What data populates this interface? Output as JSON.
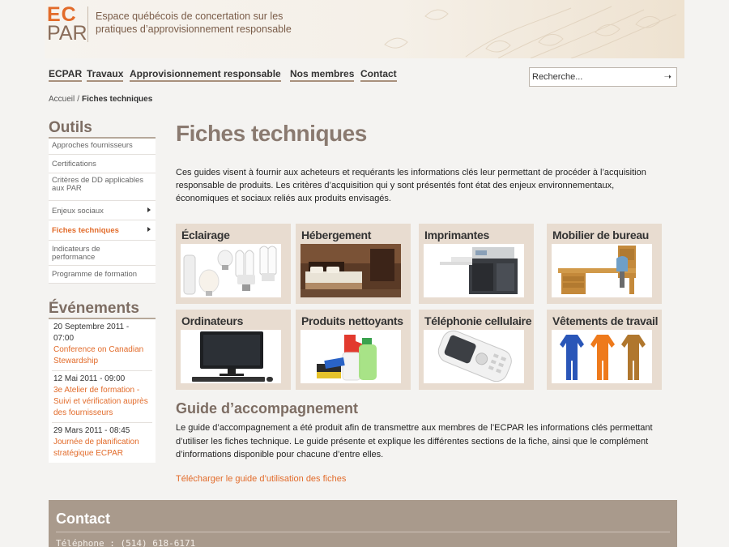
{
  "header": {
    "logo_top": "EC",
    "logo_bottom": "PAR",
    "tagline_line1": "Espace québécois de concertation sur les",
    "tagline_line2": "pratiques d’approvisionnement responsable"
  },
  "nav": {
    "items": [
      "ECPAR",
      "Travaux",
      "Approvisionnement responsable",
      "Nos membres",
      "Contact"
    ]
  },
  "search": {
    "placeholder": "Recherche...",
    "button_icon": "arrow-right-icon"
  },
  "breadcrumb": {
    "home": "Accueil",
    "separator": "/",
    "current": "Fiches techniques"
  },
  "sidebar": {
    "tools_title": "Outils",
    "tools": [
      {
        "label": "Approches fournisseurs"
      },
      {
        "label": "Certifications"
      },
      {
        "label": "Critères de DD applicables aux PAR"
      },
      {
        "label": "Enjeux sociaux"
      },
      {
        "label": "Fiches techniques"
      },
      {
        "label": "Indicateurs de performance"
      },
      {
        "label": "Programme de formation"
      }
    ],
    "events_title": "Événements",
    "events": [
      {
        "date": "20 Septembre 2011 - 07:00",
        "title": "Conference on Canadian Stewardship"
      },
      {
        "date": "12 Mai 2011 - 09:00",
        "title": "3e Atelier de formation - Suivi et vérification auprès des fournisseurs"
      },
      {
        "date": "29 Mars 2011 - 08:45",
        "title": "Journée de planification stratégique ECPAR"
      }
    ]
  },
  "main": {
    "title": "Fiches techniques",
    "intro": "Ces guides visent à fournir aux acheteurs et requérants les informations clés leur permettant de procéder à l’acquisition responsable de produits. Les critères d’acquisition qui y sont présentés font état des enjeux environnementaux, économiques et sociaux reliés aux produits envisagés.",
    "tiles": [
      {
        "label": "Éclairage",
        "icon": "light-bulbs-image"
      },
      {
        "label": "Hébergement",
        "icon": "hotel-room-image"
      },
      {
        "label": "Imprimantes",
        "icon": "printer-image"
      },
      {
        "label": "Mobilier de bureau",
        "icon": "office-desk-image"
      },
      {
        "label": "Ordinateurs",
        "icon": "computer-monitor-image"
      },
      {
        "label": "Produits nettoyants",
        "icon": "cleaning-products-image"
      },
      {
        "label": "Téléphonie cellulaire",
        "icon": "cell-phone-image"
      },
      {
        "label": "Vêtements de travail",
        "icon": "work-coveralls-image"
      }
    ],
    "guide_title": "Guide d’accompagnement",
    "guide_text": "Le guide d’accompagnement a été produit afin de transmettre aux membres de l’ECPAR les informations clés permettant d’utiliser les fiches technique. Le guide présente et explique les différentes sections de la fiche, ainsi que le complément d’informations disponible pour chacune d’entre elles.",
    "guide_link": "Télécharger le guide d’utilisation des fiches"
  },
  "footer": {
    "title": "Contact",
    "phone": "Téléphone : (514) 618-6171"
  },
  "colors": {
    "accent": "#e26b2a",
    "heading": "#8a7a70",
    "tile_bg": "#e8dcd0",
    "footer_bg": "#a99a8c"
  }
}
